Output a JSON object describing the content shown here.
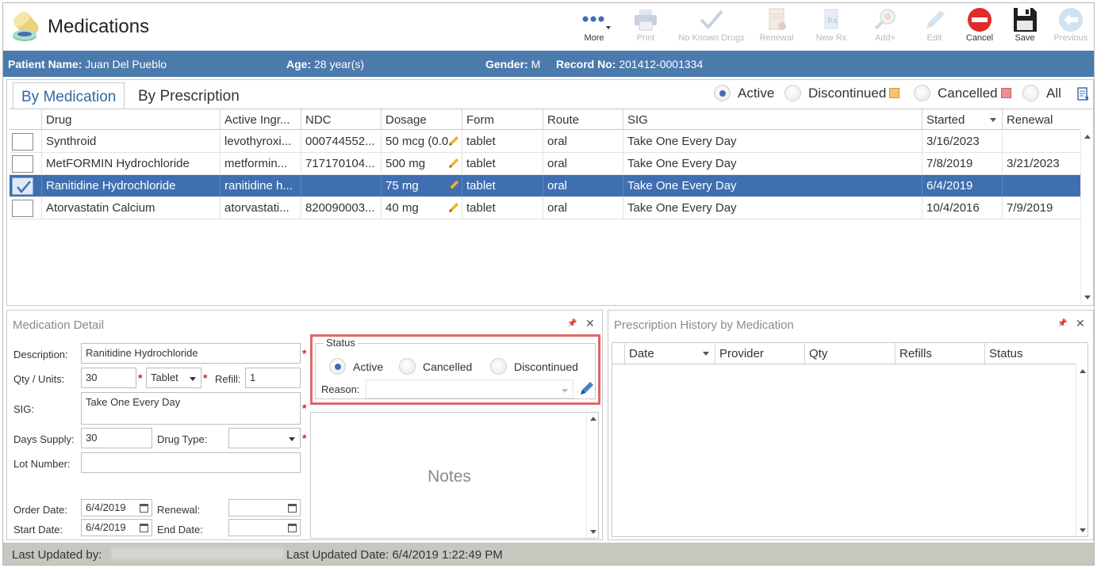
{
  "header": {
    "title": "Medications",
    "toolbar": [
      {
        "name": "more-button",
        "label": "More",
        "icon": "more-dots-icon",
        "enabled": true
      },
      {
        "name": "print-button",
        "label": "Print",
        "icon": "printer-icon",
        "enabled": false
      },
      {
        "name": "no-known-drugs-button",
        "label": "No Known Drugs",
        "icon": "checkmark-icon",
        "enabled": false
      },
      {
        "name": "renewal-button",
        "label": "Renewal",
        "icon": "renewal-document-icon",
        "enabled": false
      },
      {
        "name": "new-rx-button",
        "label": "New Rx",
        "icon": "new-rx-icon",
        "enabled": false
      },
      {
        "name": "add-plus-button",
        "label": "Add+",
        "icon": "magnifier-pill-icon",
        "enabled": false
      },
      {
        "name": "edit-button",
        "label": "Edit",
        "icon": "pencil-icon",
        "enabled": false
      },
      {
        "name": "cancel-button",
        "label": "Cancel",
        "icon": "cancel-circle-icon",
        "enabled": true
      },
      {
        "name": "save-button",
        "label": "Save",
        "icon": "floppy-disk-icon",
        "enabled": true
      },
      {
        "name": "previous-button",
        "label": "Previous",
        "icon": "back-arrow-icon",
        "enabled": false
      }
    ]
  },
  "patient": {
    "name_label": "Patient Name:",
    "name": "Juan Del Pueblo",
    "age_label": "Age:",
    "age": "28 year(s)",
    "gender_label": "Gender:",
    "gender": "M",
    "record_label": "Record No:",
    "record": "201412-0001334"
  },
  "med_list": {
    "tabs": [
      "By Medication",
      "By Prescription"
    ],
    "filters": {
      "active": "Active",
      "discontinued": "Discontinued",
      "cancelled": "Cancelled",
      "all": "All",
      "selected": "Active",
      "discontinued_color": "#f6c46b",
      "cancelled_color": "#ef8f8f"
    },
    "columns": [
      "Drug",
      "Active Ingr...",
      "NDC",
      "Dosage",
      "Form",
      "Route",
      "SIG",
      "Started",
      "Renewal"
    ],
    "rows": [
      {
        "checked": false,
        "selected": false,
        "drug": "Synthroid",
        "ingredient": "levothyroxi...",
        "ndc": "000744552...",
        "dosage": "50 mcg (0.0",
        "form": "tablet",
        "route": "oral",
        "sig": "Take One Every Day",
        "started": "3/16/2023",
        "renewal": ""
      },
      {
        "checked": false,
        "selected": false,
        "drug": "MetFORMIN Hydrochloride",
        "ingredient": "metformin...",
        "ndc": "717170104...",
        "dosage": "500 mg",
        "form": "tablet",
        "route": "oral",
        "sig": "Take One Every Day",
        "started": "7/8/2019",
        "renewal": "3/21/2023"
      },
      {
        "checked": true,
        "selected": true,
        "drug": "Ranitidine Hydrochloride",
        "ingredient": "ranitidine h...",
        "ndc": "",
        "dosage": "75 mg",
        "form": "tablet",
        "route": "oral",
        "sig": "Take One Every Day",
        "started": "6/4/2019",
        "renewal": ""
      },
      {
        "checked": false,
        "selected": false,
        "drug": "Atorvastatin Calcium",
        "ingredient": "atorvastati...",
        "ndc": "820090003...",
        "dosage": "40 mg",
        "form": "tablet",
        "route": "oral",
        "sig": "Take One Every Day",
        "started": "10/4/2016",
        "renewal": "7/9/2019"
      }
    ]
  },
  "detail": {
    "title": "Medication Detail",
    "description_label": "Description:",
    "description": "Ranitidine Hydrochloride",
    "qty_label": "Qty / Units:",
    "qty": "30",
    "units": "Tablet",
    "refill_label": "Refill:",
    "refill": "1",
    "sig_label": "SIG:",
    "sig": "Take One Every Day",
    "days_supply_label": "Days Supply:",
    "days_supply": "30",
    "drug_type_label": "Drug Type:",
    "drug_type": "",
    "lot_label": "Lot Number:",
    "lot": "",
    "order_date_label": "Order Date:",
    "order_date": "6/4/2019",
    "renewal_label": "Renewal:",
    "renewal": "",
    "start_date_label": "Start Date:",
    "start_date": "6/4/2019",
    "end_date_label": "End Date:",
    "end_date": "",
    "status": {
      "legend": "Status",
      "active": "Active",
      "cancelled": "Cancelled",
      "discontinued": "Discontinued",
      "selected": "Active",
      "reason_label": "Reason:",
      "reason": ""
    },
    "notes_placeholder": "Notes"
  },
  "history": {
    "title": "Prescription History by Medication",
    "columns": [
      "Date",
      "Provider",
      "Qty",
      "Refills",
      "Status"
    ]
  },
  "footer": {
    "updated_by_label": "Last Updated by:",
    "updated_date_label": "Last Updated Date:",
    "updated_date": "6/4/2019 1:22:49 PM"
  },
  "colors": {
    "patient_bar": "#4b7aad",
    "selected_row": "#3f6fb0",
    "highlight_border": "#e06666",
    "footer": "#c7c7c0",
    "cancel_red": "#e02b2b"
  }
}
